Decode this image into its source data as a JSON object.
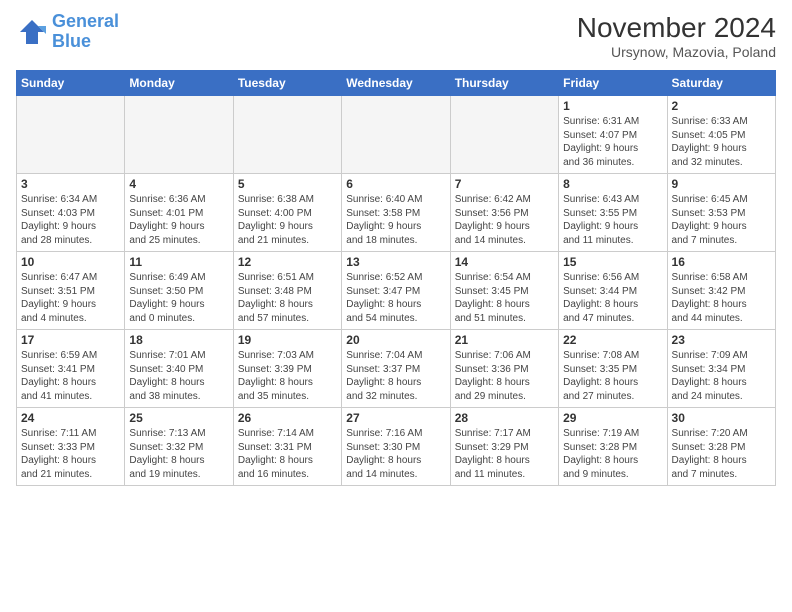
{
  "header": {
    "logo_line1": "General",
    "logo_line2": "Blue",
    "month_title": "November 2024",
    "location": "Ursynow, Mazovia, Poland"
  },
  "weekdays": [
    "Sunday",
    "Monday",
    "Tuesday",
    "Wednesday",
    "Thursday",
    "Friday",
    "Saturday"
  ],
  "weeks": [
    [
      {
        "day": "",
        "detail": "",
        "empty": true
      },
      {
        "day": "",
        "detail": "",
        "empty": true
      },
      {
        "day": "",
        "detail": "",
        "empty": true
      },
      {
        "day": "",
        "detail": "",
        "empty": true
      },
      {
        "day": "",
        "detail": "",
        "empty": true
      },
      {
        "day": "1",
        "detail": "Sunrise: 6:31 AM\nSunset: 4:07 PM\nDaylight: 9 hours\nand 36 minutes.",
        "empty": false
      },
      {
        "day": "2",
        "detail": "Sunrise: 6:33 AM\nSunset: 4:05 PM\nDaylight: 9 hours\nand 32 minutes.",
        "empty": false
      }
    ],
    [
      {
        "day": "3",
        "detail": "Sunrise: 6:34 AM\nSunset: 4:03 PM\nDaylight: 9 hours\nand 28 minutes.",
        "empty": false
      },
      {
        "day": "4",
        "detail": "Sunrise: 6:36 AM\nSunset: 4:01 PM\nDaylight: 9 hours\nand 25 minutes.",
        "empty": false
      },
      {
        "day": "5",
        "detail": "Sunrise: 6:38 AM\nSunset: 4:00 PM\nDaylight: 9 hours\nand 21 minutes.",
        "empty": false
      },
      {
        "day": "6",
        "detail": "Sunrise: 6:40 AM\nSunset: 3:58 PM\nDaylight: 9 hours\nand 18 minutes.",
        "empty": false
      },
      {
        "day": "7",
        "detail": "Sunrise: 6:42 AM\nSunset: 3:56 PM\nDaylight: 9 hours\nand 14 minutes.",
        "empty": false
      },
      {
        "day": "8",
        "detail": "Sunrise: 6:43 AM\nSunset: 3:55 PM\nDaylight: 9 hours\nand 11 minutes.",
        "empty": false
      },
      {
        "day": "9",
        "detail": "Sunrise: 6:45 AM\nSunset: 3:53 PM\nDaylight: 9 hours\nand 7 minutes.",
        "empty": false
      }
    ],
    [
      {
        "day": "10",
        "detail": "Sunrise: 6:47 AM\nSunset: 3:51 PM\nDaylight: 9 hours\nand 4 minutes.",
        "empty": false
      },
      {
        "day": "11",
        "detail": "Sunrise: 6:49 AM\nSunset: 3:50 PM\nDaylight: 9 hours\nand 0 minutes.",
        "empty": false
      },
      {
        "day": "12",
        "detail": "Sunrise: 6:51 AM\nSunset: 3:48 PM\nDaylight: 8 hours\nand 57 minutes.",
        "empty": false
      },
      {
        "day": "13",
        "detail": "Sunrise: 6:52 AM\nSunset: 3:47 PM\nDaylight: 8 hours\nand 54 minutes.",
        "empty": false
      },
      {
        "day": "14",
        "detail": "Sunrise: 6:54 AM\nSunset: 3:45 PM\nDaylight: 8 hours\nand 51 minutes.",
        "empty": false
      },
      {
        "day": "15",
        "detail": "Sunrise: 6:56 AM\nSunset: 3:44 PM\nDaylight: 8 hours\nand 47 minutes.",
        "empty": false
      },
      {
        "day": "16",
        "detail": "Sunrise: 6:58 AM\nSunset: 3:42 PM\nDaylight: 8 hours\nand 44 minutes.",
        "empty": false
      }
    ],
    [
      {
        "day": "17",
        "detail": "Sunrise: 6:59 AM\nSunset: 3:41 PM\nDaylight: 8 hours\nand 41 minutes.",
        "empty": false
      },
      {
        "day": "18",
        "detail": "Sunrise: 7:01 AM\nSunset: 3:40 PM\nDaylight: 8 hours\nand 38 minutes.",
        "empty": false
      },
      {
        "day": "19",
        "detail": "Sunrise: 7:03 AM\nSunset: 3:39 PM\nDaylight: 8 hours\nand 35 minutes.",
        "empty": false
      },
      {
        "day": "20",
        "detail": "Sunrise: 7:04 AM\nSunset: 3:37 PM\nDaylight: 8 hours\nand 32 minutes.",
        "empty": false
      },
      {
        "day": "21",
        "detail": "Sunrise: 7:06 AM\nSunset: 3:36 PM\nDaylight: 8 hours\nand 29 minutes.",
        "empty": false
      },
      {
        "day": "22",
        "detail": "Sunrise: 7:08 AM\nSunset: 3:35 PM\nDaylight: 8 hours\nand 27 minutes.",
        "empty": false
      },
      {
        "day": "23",
        "detail": "Sunrise: 7:09 AM\nSunset: 3:34 PM\nDaylight: 8 hours\nand 24 minutes.",
        "empty": false
      }
    ],
    [
      {
        "day": "24",
        "detail": "Sunrise: 7:11 AM\nSunset: 3:33 PM\nDaylight: 8 hours\nand 21 minutes.",
        "empty": false
      },
      {
        "day": "25",
        "detail": "Sunrise: 7:13 AM\nSunset: 3:32 PM\nDaylight: 8 hours\nand 19 minutes.",
        "empty": false
      },
      {
        "day": "26",
        "detail": "Sunrise: 7:14 AM\nSunset: 3:31 PM\nDaylight: 8 hours\nand 16 minutes.",
        "empty": false
      },
      {
        "day": "27",
        "detail": "Sunrise: 7:16 AM\nSunset: 3:30 PM\nDaylight: 8 hours\nand 14 minutes.",
        "empty": false
      },
      {
        "day": "28",
        "detail": "Sunrise: 7:17 AM\nSunset: 3:29 PM\nDaylight: 8 hours\nand 11 minutes.",
        "empty": false
      },
      {
        "day": "29",
        "detail": "Sunrise: 7:19 AM\nSunset: 3:28 PM\nDaylight: 8 hours\nand 9 minutes.",
        "empty": false
      },
      {
        "day": "30",
        "detail": "Sunrise: 7:20 AM\nSunset: 3:28 PM\nDaylight: 8 hours\nand 7 minutes.",
        "empty": false
      }
    ]
  ]
}
